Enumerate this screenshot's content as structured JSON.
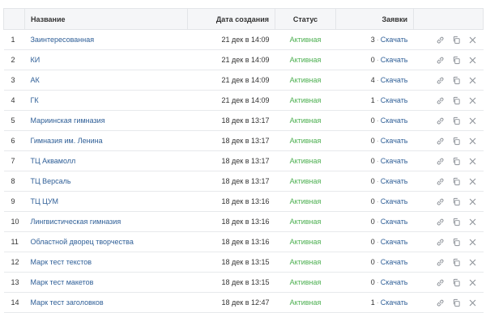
{
  "table": {
    "headers": {
      "num": "",
      "name": "Название",
      "date": "Дата создания",
      "status": "Статус",
      "apps": "Заявки",
      "actions": ""
    },
    "rows": [
      {
        "num": "1",
        "name": "Заинтересованная",
        "date": "21 дек в 14:09",
        "status": "Активная",
        "count": "3",
        "download": "Скачать"
      },
      {
        "num": "2",
        "name": "КИ",
        "date": "21 дек в 14:09",
        "status": "Активная",
        "count": "0",
        "download": "Скачать"
      },
      {
        "num": "3",
        "name": "АК",
        "date": "21 дек в 14:09",
        "status": "Активная",
        "count": "4",
        "download": "Скачать"
      },
      {
        "num": "4",
        "name": "ГК",
        "date": "21 дек в 14:09",
        "status": "Активная",
        "count": "1",
        "download": "Скачать"
      },
      {
        "num": "5",
        "name": "Мариинская гимназия",
        "date": "18 дек в 13:17",
        "status": "Активная",
        "count": "0",
        "download": "Скачать"
      },
      {
        "num": "6",
        "name": "Гимназия им. Ленина",
        "date": "18 дек в 13:17",
        "status": "Активная",
        "count": "0",
        "download": "Скачать"
      },
      {
        "num": "7",
        "name": "ТЦ Аквамолл",
        "date": "18 дек в 13:17",
        "status": "Активная",
        "count": "0",
        "download": "Скачать"
      },
      {
        "num": "8",
        "name": "ТЦ Версаль",
        "date": "18 дек в 13:17",
        "status": "Активная",
        "count": "0",
        "download": "Скачать"
      },
      {
        "num": "9",
        "name": "ТЦ ЦУМ",
        "date": "18 дек в 13:16",
        "status": "Активная",
        "count": "0",
        "download": "Скачать"
      },
      {
        "num": "10",
        "name": "Лингвистическая гимназия",
        "date": "18 дек в 13:16",
        "status": "Активная",
        "count": "0",
        "download": "Скачать"
      },
      {
        "num": "11",
        "name": "Областной дворец творчества",
        "date": "18 дек в 13:16",
        "status": "Активная",
        "count": "0",
        "download": "Скачать"
      },
      {
        "num": "12",
        "name": "Марк тест текстов",
        "date": "18 дек в 13:15",
        "status": "Активная",
        "count": "0",
        "download": "Скачать"
      },
      {
        "num": "13",
        "name": "Марк тест макетов",
        "date": "18 дек в 13:15",
        "status": "Активная",
        "count": "0",
        "download": "Скачать"
      },
      {
        "num": "14",
        "name": "Марк тест заголовков",
        "date": "18 дек в 12:47",
        "status": "Активная",
        "count": "1",
        "download": "Скачать"
      }
    ],
    "separator": "·",
    "row_icons": [
      "link-icon",
      "copy-icon",
      "close-icon"
    ]
  },
  "colors": {
    "status_active": "#4caf50",
    "link": "#2f5f97",
    "header_bg": "#f5f6f8",
    "icon": "#8a8f96"
  }
}
